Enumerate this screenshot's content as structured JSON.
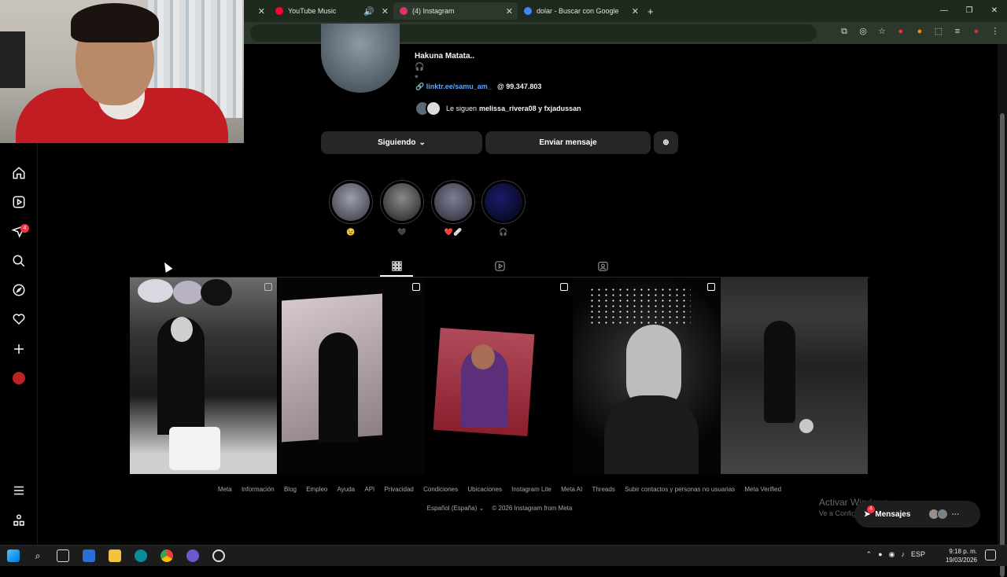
{
  "browser": {
    "tabs": [
      {
        "label": "YouTube Music",
        "color": "#ff0033"
      },
      {
        "label": "(4) Instagram",
        "color": "#e1306c",
        "active": true
      },
      {
        "label": "dolar - Buscar con Google",
        "color": "#4285f4"
      }
    ],
    "new_tab_label": "+"
  },
  "profile": {
    "bio_name": "Hakuna Matata..",
    "bio_icon": "🎧",
    "bio_heart": "♥",
    "link": "linktr.ee/samu_am_",
    "threads_count": "99.347.803",
    "followed_by_prefix": "Le siguen",
    "followed_by_names": "melissa_rivera08 y fxjadussan"
  },
  "actions": {
    "following_label": "Siguiendo",
    "message_label": "Enviar mensaje"
  },
  "highlights": [
    {
      "label": "😉",
      "color": "#5a5a68"
    },
    {
      "label": "🖤",
      "color": "#3a3a3a"
    },
    {
      "label": "❤️🩹",
      "color": "#4a4a58"
    },
    {
      "label": "🎧",
      "color": "#141426"
    }
  ],
  "posts": [
    {
      "id": "birthday"
    },
    {
      "id": "silhouette"
    },
    {
      "id": "singer"
    },
    {
      "id": "mic-bw"
    },
    {
      "id": "football"
    }
  ],
  "footer": {
    "links": [
      "Meta",
      "Información",
      "Blog",
      "Empleo",
      "Ayuda",
      "API",
      "Privacidad",
      "Condiciones",
      "Ubicaciones",
      "Instagram Lite",
      "Meta AI",
      "Threads",
      "Subir contactos y personas no usuarias",
      "Meta Verified"
    ],
    "language": "Español (España)",
    "copyright": "© 2026 Instagram from Meta"
  },
  "windows": {
    "activate_title": "Activar Windows",
    "activate_sub": "Ve a Configuración para activar Windows.",
    "messages_label": "Mensajes",
    "messages_badge": "4",
    "notifications_badge": "4",
    "tray_lang": "ESP",
    "time": "9:18 p. m.",
    "date": "19/03/2026"
  }
}
